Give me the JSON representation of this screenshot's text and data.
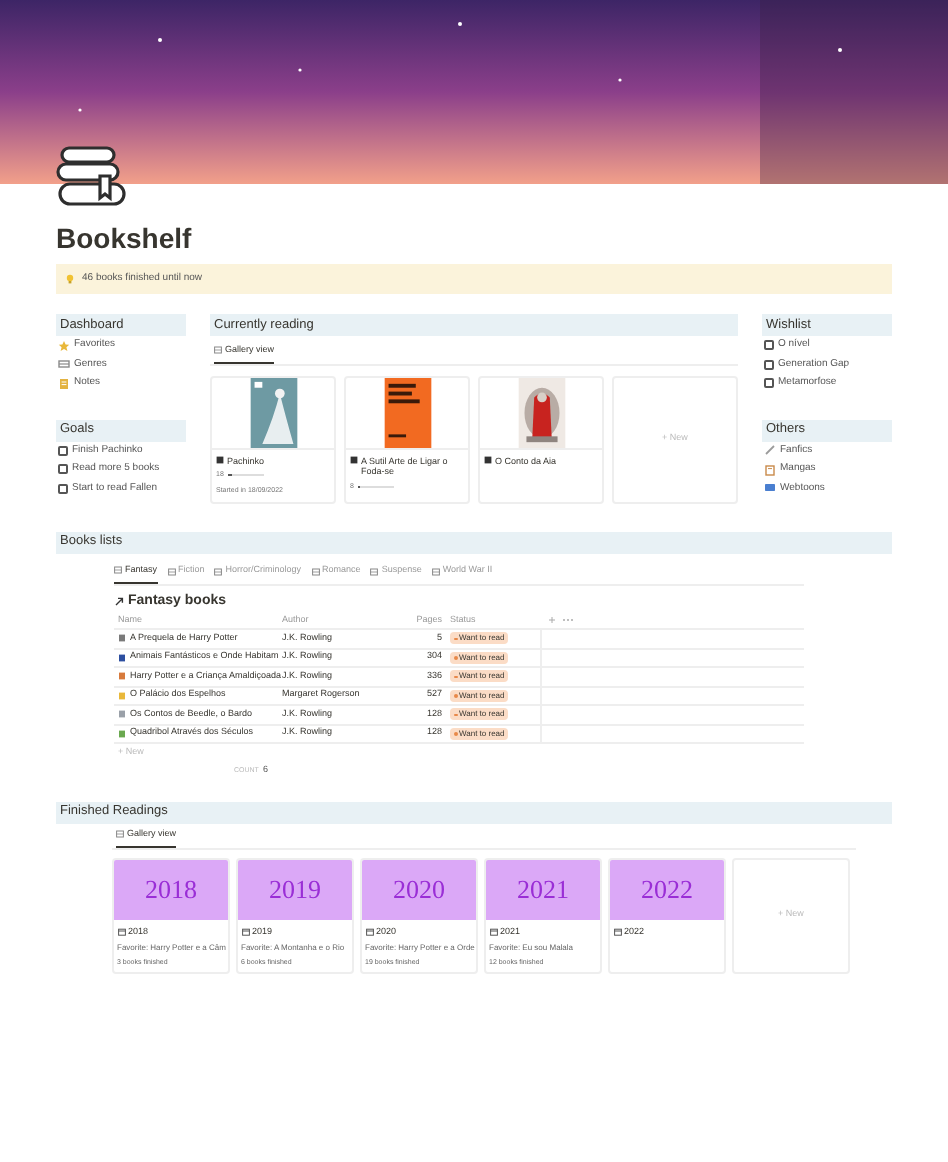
{
  "page": {
    "title": "Bookshelf",
    "callout": "46 books finished until now"
  },
  "dashboard": {
    "title": "Dashboard",
    "items": [
      {
        "label": "Favorites"
      },
      {
        "label": "Genres"
      },
      {
        "label": "Notes"
      }
    ]
  },
  "goals": {
    "title": "Goals",
    "items": [
      {
        "label": "Finish Pachinko",
        "checked": false
      },
      {
        "label": "Read more 5 books",
        "checked": false
      },
      {
        "label": "Start to read Fallen",
        "checked": false
      }
    ]
  },
  "currently_reading": {
    "title": "Currently reading",
    "tabs": [
      {
        "label": "Gallery view",
        "selected": true
      }
    ],
    "new_label": "+ New",
    "cards": [
      {
        "title": "Pachinko",
        "progress": "18",
        "level": 0.12,
        "started": "Started in 18/09/2022"
      },
      {
        "title": "A Sutil Arte de Ligar o Foda-se",
        "progress": "8",
        "level": 0.06
      },
      {
        "title": "O Conto da Aia"
      }
    ]
  },
  "wishlist": {
    "title": "Wishlist",
    "items": [
      {
        "label": "O nível",
        "checked": false
      },
      {
        "label": "Generation Gap",
        "checked": false
      },
      {
        "label": "Metamorfose",
        "checked": false
      }
    ]
  },
  "others": {
    "title": "Others",
    "items": [
      {
        "label": "Fanfics"
      },
      {
        "label": "Mangas"
      },
      {
        "label": "Webtoons"
      }
    ]
  },
  "books_lists": {
    "title": "Books lists",
    "tabs": [
      {
        "label": "Fantasy",
        "selected": true
      },
      {
        "label": "Fiction",
        "selected": false
      },
      {
        "label": "Horror/Criminology",
        "selected": false
      },
      {
        "label": "Romance",
        "selected": false
      },
      {
        "label": "Suspense",
        "selected": false
      },
      {
        "label": "World War II",
        "selected": false
      }
    ],
    "table_title": "Fantasy books",
    "columns": [
      "Name",
      "Author",
      "Pages",
      "Status"
    ],
    "new_label": "+ New",
    "count_label": "COUNT",
    "count": "6",
    "rows": [
      {
        "name": "A Prequela de Harry Potter",
        "author": "J.K. Rowling",
        "pages": "5",
        "status": "Want to read",
        "color": "#fbdcc6"
      },
      {
        "name": "Animais Fantásticos e Onde Habitam",
        "author": "J.K. Rowling",
        "pages": "304",
        "status": "Want to read",
        "color": "#fbdcc6"
      },
      {
        "name": "Harry Potter e a Criança Amaldiçoada",
        "author": "J.K. Rowling",
        "pages": "336",
        "status": "Want to read",
        "color": "#fbdcc6"
      },
      {
        "name": "O Palácio dos Espelhos",
        "author": "Margaret Rogerson",
        "pages": "527",
        "status": "Want to read",
        "color": "#fbdcc6"
      },
      {
        "name": "Os Contos de Beedle, o Bardo",
        "author": "J.K. Rowling",
        "pages": "128",
        "status": "Want to read",
        "color": "#fbdcc6"
      },
      {
        "name": "Quadribol Através dos Séculos",
        "author": "J.K. Rowling",
        "pages": "128",
        "status": "Want to read",
        "color": "#fbdcc6"
      }
    ]
  },
  "finished_readings": {
    "title": "Finished Readings",
    "tabs": [
      {
        "label": "Gallery view",
        "selected": true
      }
    ],
    "new_label": "+ New",
    "cards": [
      {
        "cover_year": "2018",
        "title": "2018",
        "favorite": "Favorite: Harry Potter e a Câm",
        "finished": "3 books finished"
      },
      {
        "cover_year": "2019",
        "title": "2019",
        "favorite": "Favorite: A Montanha e o Rio",
        "finished": "6 books finished"
      },
      {
        "cover_year": "2020",
        "title": "2020",
        "favorite": "Favorite: Harry Potter e a Orde",
        "finished": "19 books finished"
      },
      {
        "cover_year": "2021",
        "title": "2021",
        "favorite": "Favorite: Eu sou Malala",
        "finished": "12 books finished"
      },
      {
        "cover_year": "2022",
        "title": "2022"
      }
    ]
  }
}
